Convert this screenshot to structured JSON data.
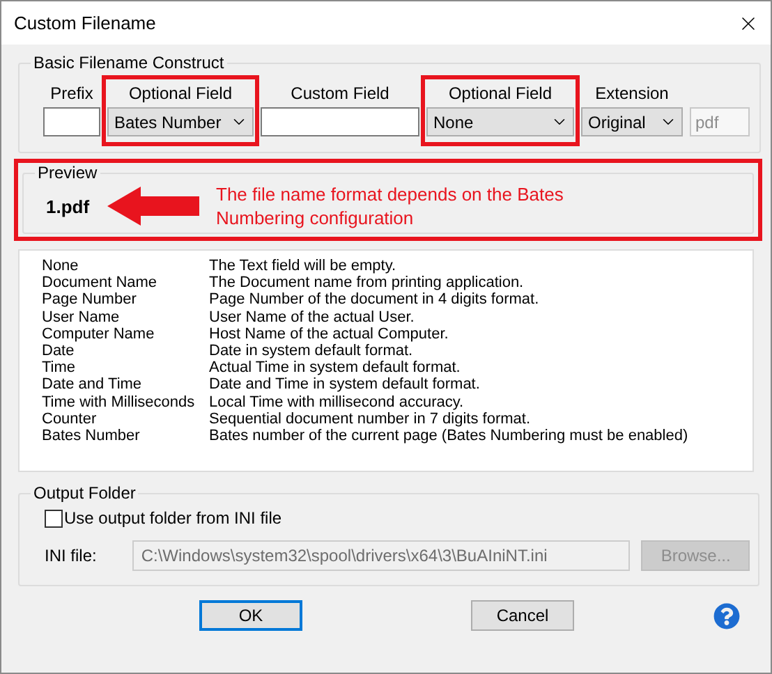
{
  "window": {
    "title": "Custom Filename"
  },
  "basic_group": {
    "legend": "Basic Filename Construct",
    "fields": [
      {
        "kind": "input",
        "label": "Prefix",
        "highlighted": false
      },
      {
        "kind": "select",
        "label": "Optional Field",
        "value": "Bates Number",
        "highlighted": true
      },
      {
        "kind": "input",
        "label": "Custom Field",
        "highlighted": false
      },
      {
        "kind": "select",
        "label": "Optional Field",
        "value": "None",
        "highlighted": true
      },
      {
        "kind": "select",
        "label": "Extension",
        "value": "Original",
        "highlighted": false
      },
      {
        "kind": "readonly",
        "value": "pdf",
        "disabled": true,
        "highlighted": false
      }
    ]
  },
  "preview": {
    "legend": "Preview",
    "filename": "1.pdf",
    "highlighted": true,
    "callout": "The file name format depends on the Bates Numbering configuration"
  },
  "options": [
    {
      "name": "None",
      "description": "The Text field will be empty."
    },
    {
      "name": "Document Name",
      "description": "The Document name from printing application."
    },
    {
      "name": "Page Number",
      "description": "Page Number of the document in 4 digits format."
    },
    {
      "name": "User Name",
      "description": "User Name of the actual User."
    },
    {
      "name": "Computer Name",
      "description": "Host Name of the actual Computer."
    },
    {
      "name": "Date",
      "description": "Date in system default format."
    },
    {
      "name": "Time",
      "description": "Actual Time in system default format."
    },
    {
      "name": "Date and Time",
      "description": "Date and Time in system default format."
    },
    {
      "name": "Time with Milliseconds",
      "description": "Local Time with millisecond accuracy."
    },
    {
      "name": "Counter",
      "description": "Sequential document number in 7 digits format."
    },
    {
      "name": "Bates Number",
      "description": "Bates number of the current page (Bates Numbering must be enabled)"
    }
  ],
  "output_group": {
    "legend": "Output Folder",
    "checkbox": {
      "label": "Use output folder from INI file",
      "checked": false
    },
    "ini_label": "INI file:",
    "ini_path": "C:\\Windows\\system32\\spool\\drivers\\x64\\3\\BuAIniNT.ini",
    "ini_disabled": true,
    "browse": {
      "label": "Browse...",
      "disabled": true
    }
  },
  "buttons": [
    {
      "label": "OK",
      "default": true
    },
    {
      "label": "Cancel",
      "default": false
    }
  ]
}
